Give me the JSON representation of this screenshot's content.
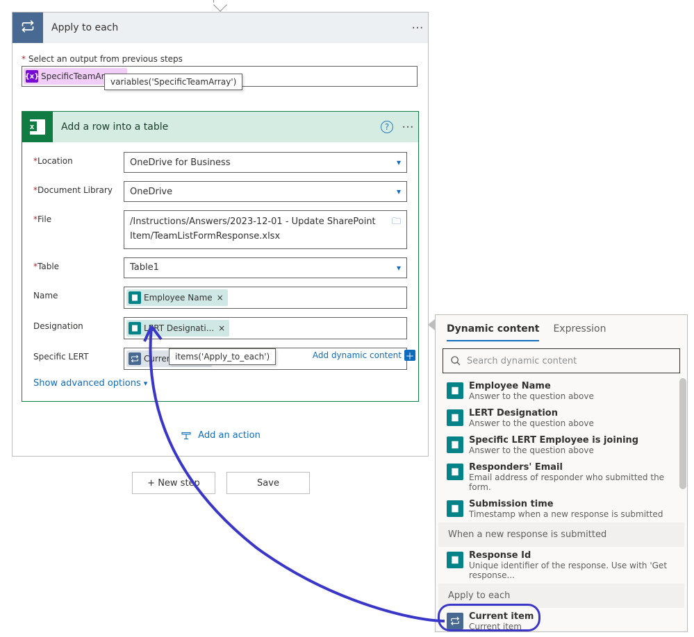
{
  "apply_each": {
    "title": "Apply to each",
    "select_label": "Select an output from previous steps",
    "select_required_marker": "*",
    "token_label": "SpecificTeamAr...",
    "token_tooltip": "variables('SpecificTeamArray')"
  },
  "action": {
    "title": "Add a row into a table",
    "fields": {
      "location": {
        "label": "Location",
        "value": "OneDrive for Business"
      },
      "doclib": {
        "label": "Document Library",
        "value": "OneDrive"
      },
      "file": {
        "label": "File",
        "value": "/Instructions/Answers/2023-12-01 - Update SharePoint Item/TeamListFormResponse.xlsx"
      },
      "table": {
        "label": "Table",
        "value": "Table1"
      },
      "name": {
        "label": "Name",
        "token": "Employee Name"
      },
      "desig": {
        "label": "Designation",
        "token": "LERT Designati..."
      },
      "slert": {
        "label": "Specific LERT",
        "token": "Current item",
        "tooltip": "items('Apply_to_each')"
      }
    },
    "advanced": "Show advanced options",
    "add_dynamic": "Add dynamic content",
    "add_action": "Add an action"
  },
  "buttons": {
    "newstep": "+ New step",
    "save": "Save"
  },
  "dynamic": {
    "tab1": "Dynamic content",
    "tab2": "Expression",
    "search_placeholder": "Search dynamic content",
    "items": [
      {
        "icon": "forms",
        "title": "Employee Name",
        "sub": "Answer to the question above"
      },
      {
        "icon": "forms",
        "title": "LERT Designation",
        "sub": "Answer to the question above"
      },
      {
        "icon": "forms",
        "title": "Specific LERT Employee is joining",
        "sub": "Answer to the question above"
      },
      {
        "icon": "forms",
        "title": "Responders' Email",
        "sub": "Email address of responder who submitted the form."
      },
      {
        "icon": "forms",
        "title": "Submission time",
        "sub": "Timestamp when a new response is submitted"
      }
    ],
    "section1": "When a new response is submitted",
    "resp": {
      "icon": "forms",
      "title": "Response Id",
      "sub": "Unique identifier of the response. Use with 'Get response..."
    },
    "section2": "Apply to each",
    "curr": {
      "icon": "loop",
      "title": "Current item",
      "sub": "Current item"
    }
  }
}
